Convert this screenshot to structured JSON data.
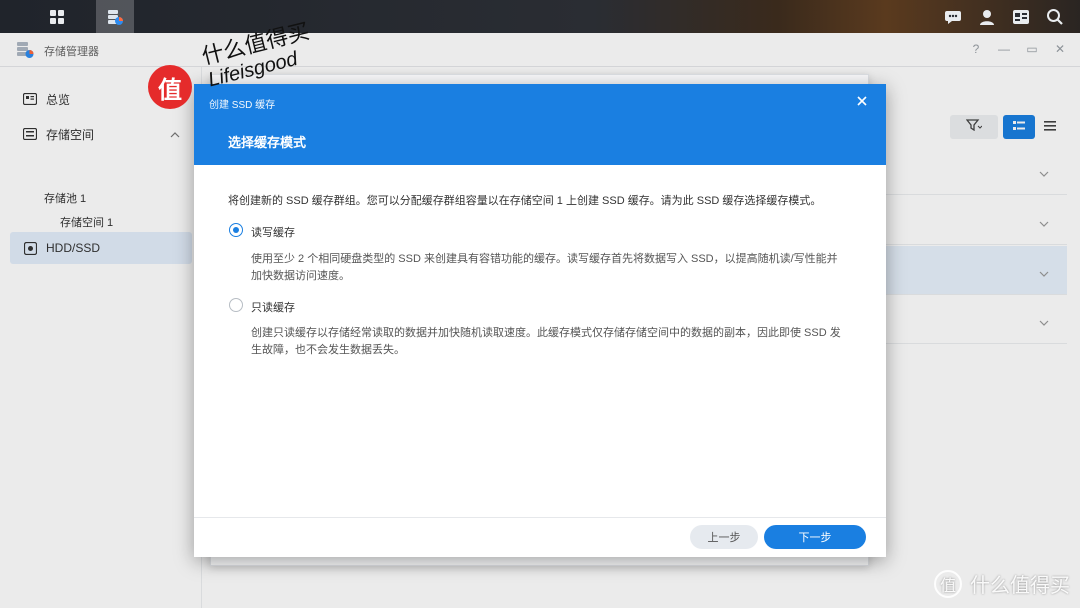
{
  "taskbar": {
    "left_icons": [
      "apps-grid-icon",
      "storage-manager-icon"
    ],
    "right_icons": [
      "chat-icon",
      "user-icon",
      "widgets-icon",
      "search-icon"
    ]
  },
  "window": {
    "title": "存储管理器",
    "controls": {
      "help": "?",
      "minimize": "—",
      "restore": "▭",
      "close": "✕"
    }
  },
  "sidebar": {
    "overview": "总览",
    "storage": "存储空间",
    "pool": "存储池 1",
    "volume": "存储空间 1",
    "hdd": "HDD/SSD"
  },
  "dialog": {
    "title": "创建 SSD 缓存",
    "heading": "选择缓存模式",
    "intro": "将创建新的 SSD 缓存群组。您可以分配缓存群组容量以在存储空间 1 上创建 SSD 缓存。请为此 SSD 缓存选择缓存模式。",
    "options": [
      {
        "label": "读写缓存",
        "selected": true,
        "desc_line1": "使用至少 2 个相同硬盘类型的 SSD 来创建具有容错功能的缓存。读写缓存首先将数据写入 SSD，以提高随机读/写性能并",
        "desc_line2": "加快数据访问速度。"
      },
      {
        "label": "只读缓存",
        "selected": false,
        "desc_line1": "创建只读缓存以存储经常读取的数据并加快随机读取速度。此缓存模式仅存储存储空间中的数据的副本，因此即使 SSD 发",
        "desc_line2": "生故障，也不会发生数据丢失。"
      }
    ],
    "prev_button": "上一步",
    "next_button": "下一步"
  },
  "watermark": {
    "logo_char": "值",
    "line1": "什么值得买",
    "line2": "Lifeisgood",
    "corner_text": "什么值得买"
  },
  "colors": {
    "accent": "#1a7fe1",
    "sidebar_selected": "#e3eefb",
    "watermark_red": "#e52b2b"
  }
}
